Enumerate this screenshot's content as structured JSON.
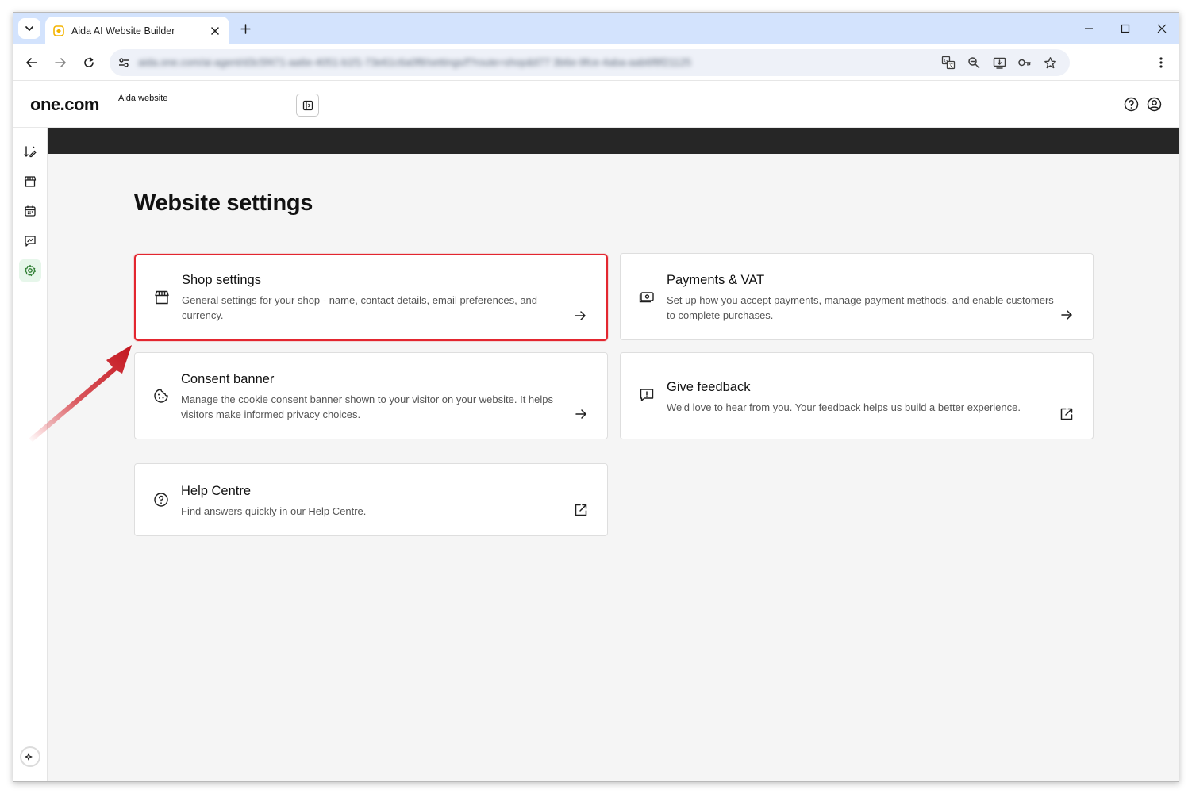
{
  "browser": {
    "tab_title": "Aida AI Website Builder",
    "url": "aida.one.com/ai-agent/d3c5f471-aa6e-4051-b1f1-73e61c6a0f8/settings/f?route=shop&tl77 3b6e-9fce-4aba-aab6f8f21125"
  },
  "app": {
    "brand": "one.com",
    "site_name": "Aida website"
  },
  "page": {
    "title": "Website settings"
  },
  "cards": {
    "shop": {
      "title": "Shop settings",
      "description": "General settings for your shop - name, contact details, email preferences, and currency."
    },
    "payments": {
      "title": "Payments & VAT",
      "description": "Set up how you accept payments, manage payment methods, and enable customers to complete purchases."
    },
    "consent": {
      "title": "Consent banner",
      "description": "Manage the cookie consent banner shown to your visitor on your website. It helps visitors make informed privacy choices."
    },
    "feedback": {
      "title": "Give feedback",
      "description": "We'd love to hear from you. Your feedback helps us build a better experience."
    },
    "help": {
      "title": "Help Centre",
      "description": "Find answers quickly in our Help Centre."
    }
  },
  "colors": {
    "highlight": "#e3262f",
    "active_rail": "#e6f6ea",
    "accent_green": "#2e7d32",
    "dark_bar": "#262626"
  }
}
